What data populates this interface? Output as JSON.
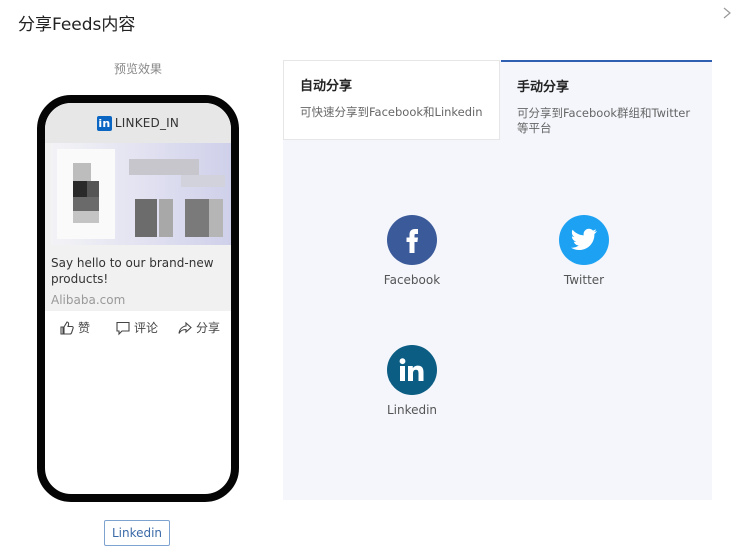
{
  "dialog": {
    "title": "分享Feeds内容"
  },
  "preview": {
    "label": "预览效果",
    "header_brand": "LINKED_IN",
    "header_logo_text": "in",
    "post_text": "Say hello to our brand-new products!",
    "post_domain": "Alibaba.com",
    "actions": {
      "like": "赞",
      "comment": "评论",
      "share": "分享"
    },
    "platform_button": "Linkedin"
  },
  "tabs": [
    {
      "title": "自动分享",
      "desc": "可快速分享到Facebook和Linkedin",
      "active": false
    },
    {
      "title": "手动分享",
      "desc": "可分享到Facebook群组和Twitter等平台",
      "active": true
    }
  ],
  "platforms": [
    {
      "name": "Facebook",
      "icon": "facebook-icon",
      "color": "#3b5a9a"
    },
    {
      "name": "Twitter",
      "icon": "twitter-icon",
      "color": "#1da1f2"
    },
    {
      "name": "Linkedin",
      "icon": "linkedin-icon",
      "color": "#0b5d84"
    }
  ],
  "colors": {
    "accent": "#2f5fb0",
    "phone_frame": "#050505"
  }
}
